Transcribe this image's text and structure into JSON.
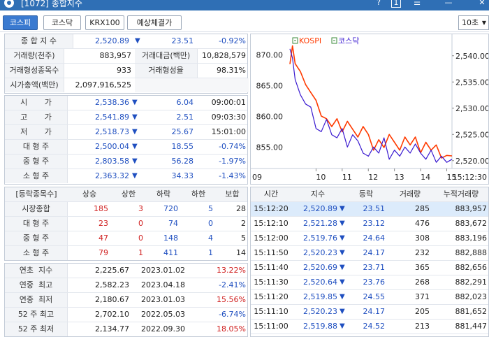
{
  "window": {
    "title": "[1072] 종합지수",
    "btn_help": "?",
    "btn_num": "1",
    "btn_menu": "☰",
    "btn_min": "—",
    "btn_close": "✕"
  },
  "tabs": [
    {
      "label": "코스피",
      "active": true
    },
    {
      "label": "코스닥",
      "active": false
    },
    {
      "label": "KRX100",
      "active": false
    },
    {
      "label": "예상체결가",
      "active": false
    }
  ],
  "interval": {
    "value": "10초"
  },
  "summary": {
    "index_label": "종 합 지 수",
    "index_value": "2,520.89",
    "index_change": "23.51",
    "index_pct": "-0.92%",
    "volume_label": "거래량(천주)",
    "volume_value": "883,957",
    "amount_label": "거래대금(백만)",
    "amount_value": "10,828,579",
    "form_count_label": "거래형성종목수",
    "form_count_value": "933",
    "form_rate_label": "거래형성율",
    "form_rate_value": "98.31%",
    "mcap_label": "시가총액(백만)",
    "mcap_value": "2,097,916,525"
  },
  "ohlc": [
    {
      "label": "시       가",
      "value": "2,538.36",
      "change": "6.04",
      "extra": "09:00:01",
      "extra_red": false
    },
    {
      "label": "고       가",
      "value": "2,541.89",
      "change": "2.51",
      "extra": "09:03:30",
      "extra_red": false
    },
    {
      "label": "저       가",
      "value": "2,518.73",
      "change": "25.67",
      "extra": "15:01:00",
      "extra_red": false
    },
    {
      "label": "대 형 주",
      "value": "2,500.04",
      "change": "18.55",
      "extra": "-0.74%",
      "extra_red": false
    },
    {
      "label": "중 형 주",
      "value": "2,803.58",
      "change": "56.28",
      "extra": "-1.97%",
      "extra_red": false
    },
    {
      "label": "소 형 주",
      "value": "2,363.32",
      "change": "34.33",
      "extra": "-1.43%",
      "extra_red": false
    }
  ],
  "updown": {
    "headers": [
      "[등락종목수]",
      "상승",
      "상한",
      "하락",
      "하한",
      "보합"
    ],
    "rows": [
      {
        "label": "시장종합",
        "up": "185",
        "uplimit": "3",
        "down": "720",
        "downlimit": "5",
        "flat": "28"
      },
      {
        "label": "대 형 주",
        "up": "23",
        "uplimit": "0",
        "down": "74",
        "downlimit": "0",
        "flat": "2"
      },
      {
        "label": "중 형 주",
        "up": "47",
        "uplimit": "0",
        "down": "148",
        "downlimit": "4",
        "flat": "5"
      },
      {
        "label": "소 형 주",
        "up": "79",
        "uplimit": "1",
        "down": "411",
        "downlimit": "1",
        "flat": "14"
      }
    ]
  },
  "yearly": [
    {
      "label": "연초  지수",
      "value": "2,225.67",
      "date": "2023.01.02",
      "pct": "13.22%",
      "pct_red": true
    },
    {
      "label": "연중  최고",
      "value": "2,582.23",
      "date": "2023.04.18",
      "pct": "-2.41%",
      "pct_red": false
    },
    {
      "label": "연중  최저",
      "value": "2,180.67",
      "date": "2023.01.03",
      "pct": "15.56%",
      "pct_red": true
    },
    {
      "label": "52 주 최고",
      "value": "2,702.10",
      "date": "2022.05.03",
      "pct": "-6.74%",
      "pct_red": false
    },
    {
      "label": "52 주 최저",
      "value": "2,134.77",
      "date": "2022.09.30",
      "pct": "18.05%",
      "pct_red": true
    }
  ],
  "ticks": {
    "headers": [
      "시간",
      "지수",
      "등락",
      "거래량",
      "누적거래량"
    ],
    "rows": [
      {
        "time": "15:12:20",
        "index": "2,520.89",
        "change": "23.51",
        "volume": "285",
        "cum": "883,957",
        "highlight": true
      },
      {
        "time": "15:12:10",
        "index": "2,521.28",
        "change": "23.12",
        "volume": "476",
        "cum": "883,672",
        "highlight": false
      },
      {
        "time": "15:12:00",
        "index": "2,519.76",
        "change": "24.64",
        "volume": "308",
        "cum": "883,196",
        "highlight": false
      },
      {
        "time": "15:11:50",
        "index": "2,520.23",
        "change": "24.17",
        "volume": "232",
        "cum": "882,888",
        "highlight": false
      },
      {
        "time": "15:11:40",
        "index": "2,520.69",
        "change": "23.71",
        "volume": "365",
        "cum": "882,656",
        "highlight": false
      },
      {
        "time": "15:11:30",
        "index": "2,520.64",
        "change": "23.76",
        "volume": "268",
        "cum": "882,291",
        "highlight": false
      },
      {
        "time": "15:11:20",
        "index": "2,519.85",
        "change": "24.55",
        "volume": "371",
        "cum": "882,023",
        "highlight": false
      },
      {
        "time": "15:11:10",
        "index": "2,520.23",
        "change": "24.17",
        "volume": "205",
        "cum": "881,652",
        "highlight": false
      },
      {
        "time": "15:11:00",
        "index": "2,519.88",
        "change": "24.52",
        "volume": "213",
        "cum": "881,447",
        "highlight": false
      }
    ]
  },
  "chart_data": {
    "type": "line",
    "legend": [
      "KOSPI",
      "코스닥"
    ],
    "x_ticks": [
      "09",
      "10",
      "11",
      "12",
      "13",
      "14",
      "15",
      "15:12:30"
    ],
    "left_axis": {
      "ticks": [
        "870.00",
        "865.00",
        "860.00",
        "855.00"
      ],
      "range": [
        851.5,
        872
      ]
    },
    "right_axis": {
      "ticks": [
        "2,540.00",
        "2,535.00",
        "2,530.00",
        "2,525.00",
        "2,520.00"
      ],
      "range": [
        2518.5,
        2542.5
      ]
    },
    "series": [
      {
        "name": "KOSPI",
        "color": "#ff3a00",
        "axis": "right",
        "points": [
          [
            9.0,
            2538.4
          ],
          [
            9.1,
            2541.9
          ],
          [
            9.2,
            2538.5
          ],
          [
            9.4,
            2537.0
          ],
          [
            9.6,
            2534.5
          ],
          [
            9.8,
            2533.0
          ],
          [
            10.0,
            2531.5
          ],
          [
            10.2,
            2528.5
          ],
          [
            10.4,
            2528.0
          ],
          [
            10.6,
            2526.5
          ],
          [
            10.8,
            2528.0
          ],
          [
            11.0,
            2525.5
          ],
          [
            11.2,
            2527.5
          ],
          [
            11.4,
            2526.0
          ],
          [
            11.6,
            2524.5
          ],
          [
            11.8,
            2526.5
          ],
          [
            12.0,
            2525.0
          ],
          [
            12.2,
            2522.0
          ],
          [
            12.4,
            2524.0
          ],
          [
            12.6,
            2522.5
          ],
          [
            12.8,
            2525.0
          ],
          [
            13.0,
            2523.5
          ],
          [
            13.2,
            2522.0
          ],
          [
            13.4,
            2524.5
          ],
          [
            13.6,
            2523.0
          ],
          [
            13.8,
            2524.5
          ],
          [
            14.0,
            2521.5
          ],
          [
            14.2,
            2523.5
          ],
          [
            14.4,
            2522.0
          ],
          [
            14.6,
            2523.0
          ],
          [
            14.8,
            2520.5
          ],
          [
            15.0,
            2521.0
          ],
          [
            15.2,
            2520.9
          ]
        ]
      },
      {
        "name": "코스닥",
        "color": "#3a1ad0",
        "axis": "left",
        "points": [
          [
            9.0,
            871.0
          ],
          [
            9.1,
            869.5
          ],
          [
            9.2,
            866.0
          ],
          [
            9.4,
            863.5
          ],
          [
            9.6,
            862.0
          ],
          [
            9.8,
            861.5
          ],
          [
            10.0,
            858.0
          ],
          [
            10.2,
            857.5
          ],
          [
            10.4,
            859.5
          ],
          [
            10.6,
            857.0
          ],
          [
            10.8,
            856.5
          ],
          [
            11.0,
            858.0
          ],
          [
            11.2,
            855.0
          ],
          [
            11.4,
            857.0
          ],
          [
            11.6,
            856.0
          ],
          [
            11.8,
            854.0
          ],
          [
            12.0,
            853.5
          ],
          [
            12.2,
            855.0
          ],
          [
            12.4,
            854.0
          ],
          [
            12.6,
            856.5
          ],
          [
            12.8,
            853.0
          ],
          [
            13.0,
            854.5
          ],
          [
            13.2,
            853.5
          ],
          [
            13.4,
            855.0
          ],
          [
            13.6,
            854.0
          ],
          [
            13.8,
            855.5
          ],
          [
            14.0,
            854.0
          ],
          [
            14.2,
            853.0
          ],
          [
            14.4,
            854.5
          ],
          [
            14.6,
            852.5
          ],
          [
            14.8,
            853.5
          ],
          [
            15.0,
            852.5
          ],
          [
            15.2,
            853.0
          ]
        ]
      }
    ]
  }
}
